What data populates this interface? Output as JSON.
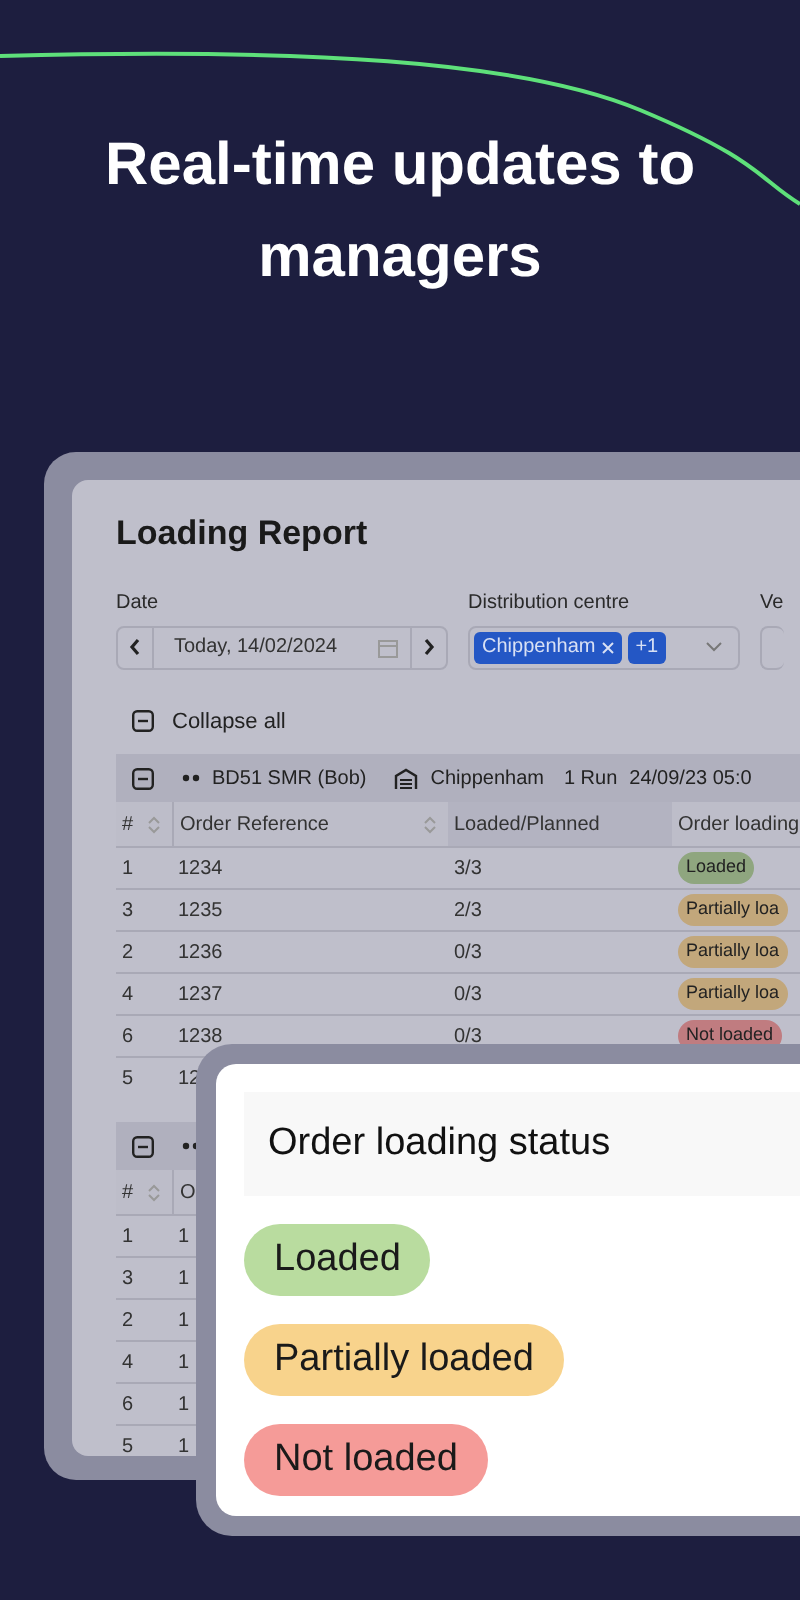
{
  "headline": "Real-time updates to managers",
  "report": {
    "title": "Loading Report",
    "date": {
      "label": "Date",
      "value": "Today, 14/02/2024"
    },
    "distribution": {
      "label": "Distribution centre",
      "chips": [
        "Chippenham",
        "+1"
      ]
    },
    "vehicle": {
      "label": "Ve"
    },
    "collapse_all": "Collapse all",
    "groups": [
      {
        "vehicle": "BD51 SMR (Bob)",
        "centre": "Chippenham",
        "runs": "1 Run",
        "time": "24/09/23 05:0",
        "expanded": true,
        "columns": [
          "#",
          "Order Reference",
          "Loaded/Planned",
          "Order loading"
        ],
        "rows": [
          {
            "num": "1",
            "ref": "1234",
            "loaded": "3/3",
            "status": "Loaded",
            "color": "#8fa67f"
          },
          {
            "num": "3",
            "ref": "1235",
            "loaded": "2/3",
            "status": "Partially loa",
            "color": "#c2a77b"
          },
          {
            "num": "2",
            "ref": "1236",
            "loaded": "0/3",
            "status": "Partially loa",
            "color": "#c2a77b"
          },
          {
            "num": "4",
            "ref": "1237",
            "loaded": "0/3",
            "status": "Partially loa",
            "color": "#c2a77b"
          },
          {
            "num": "6",
            "ref": "1238",
            "loaded": "0/3",
            "status": "Not loaded",
            "color": "#c07c80"
          },
          {
            "num": "5",
            "ref": "12"
          }
        ]
      },
      {
        "expanded": true,
        "columns": [
          "#",
          "O"
        ],
        "rows": [
          {
            "num": "1",
            "ref": "1"
          },
          {
            "num": "3",
            "ref": "1"
          },
          {
            "num": "2",
            "ref": "1"
          },
          {
            "num": "4",
            "ref": "1"
          },
          {
            "num": "6",
            "ref": "1"
          },
          {
            "num": "5",
            "ref": "1"
          }
        ]
      }
    ]
  },
  "legend": {
    "title": "Order loading status",
    "items": [
      {
        "label": "Loaded",
        "color": "#b9dc9f"
      },
      {
        "label": "Partially loaded",
        "color": "#f8d38c"
      },
      {
        "label": "Not loaded",
        "color": "#f59b98"
      }
    ]
  }
}
